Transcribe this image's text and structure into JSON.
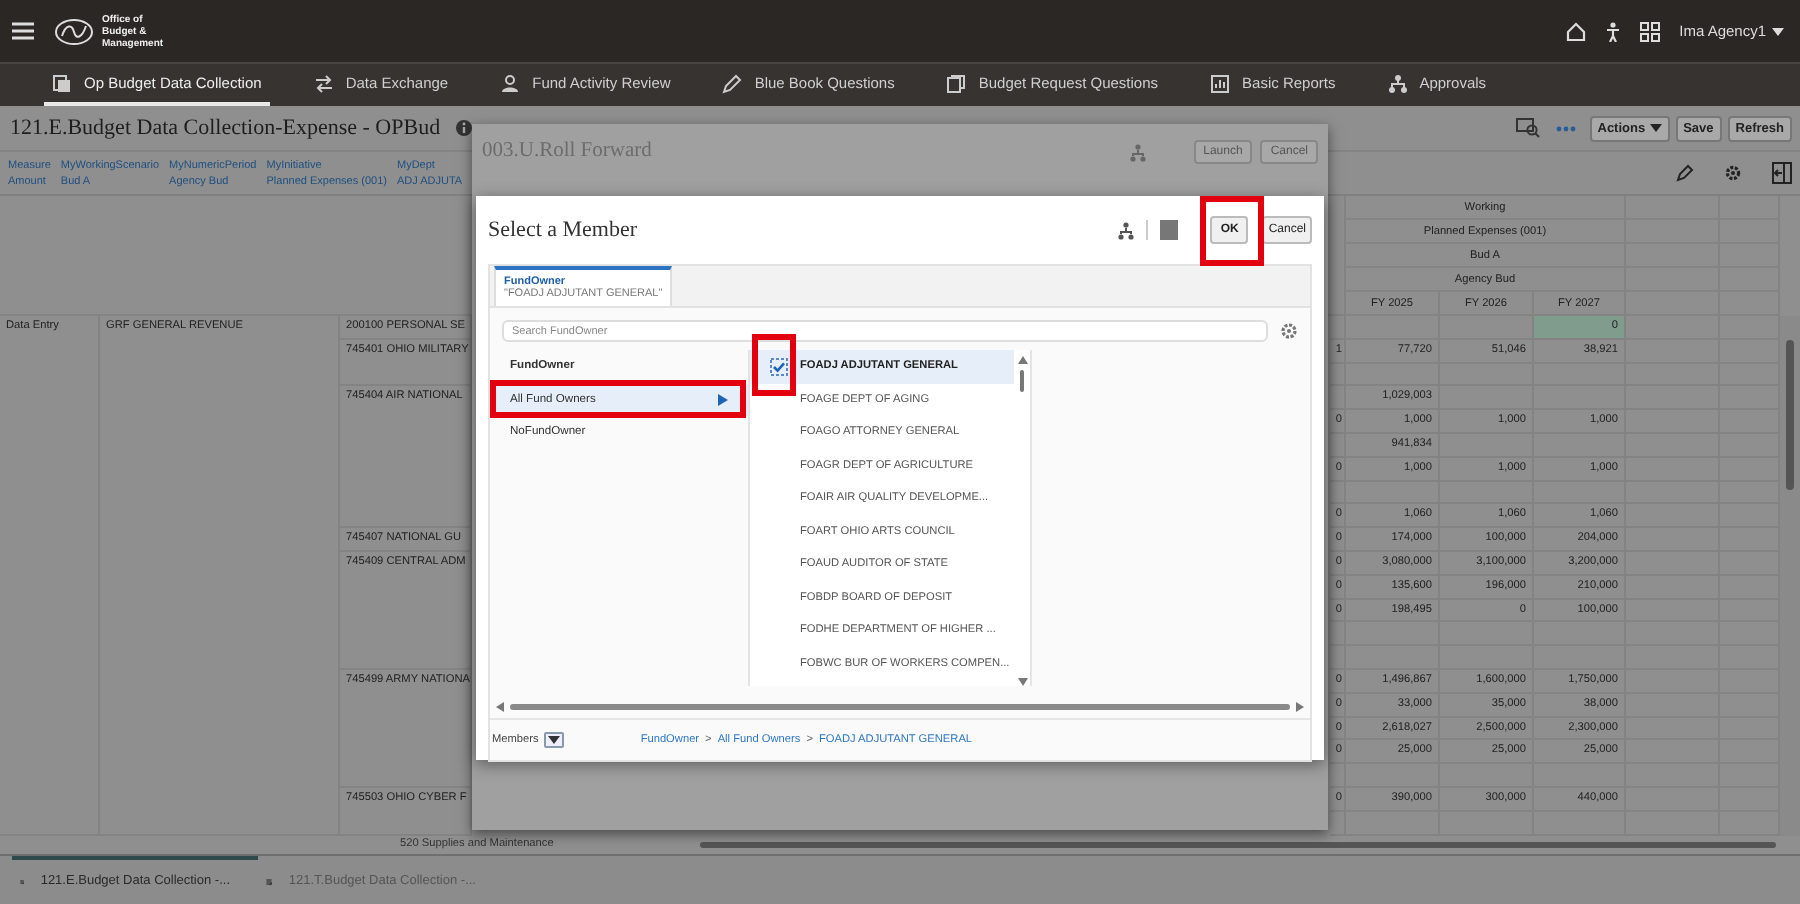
{
  "top_bar": {
    "logo_text": "Office of Budget & Management",
    "user": "Ima Agency1"
  },
  "nav_tabs": [
    {
      "label": "Op Budget Data Collection",
      "selected": true
    },
    {
      "label": "Data Exchange",
      "selected": false
    },
    {
      "label": "Fund Activity Review",
      "selected": false
    },
    {
      "label": "Blue Book Questions",
      "selected": false
    },
    {
      "label": "Budget Request Questions",
      "selected": false
    },
    {
      "label": "Basic Reports",
      "selected": false
    },
    {
      "label": "Approvals",
      "selected": false
    }
  ],
  "page": {
    "title": "121.E.Budget Data Collection-Expense - OPBud",
    "actions": "Actions",
    "save": "Save",
    "refresh": "Refresh"
  },
  "pov": [
    {
      "dimension": "Measure",
      "member": "Amount"
    },
    {
      "dimension": "MyWorkingScenario",
      "member": "Bud A"
    },
    {
      "dimension": "MyNumericPeriod",
      "member": "Agency Bud"
    },
    {
      "dimension": "MyInitiative",
      "member": "Planned Expenses (001)"
    },
    {
      "dimension": "MyDept",
      "member": "ADJ ADJUTA"
    }
  ],
  "grid": {
    "column_headers": [
      "Working",
      "Planned Expenses (001)",
      "Bud A",
      "Agency Bud"
    ],
    "years": [
      "FY 2025",
      "FY 2026",
      "FY 2027"
    ],
    "plan_type": "Data Entry",
    "fund": "GRF GENERAL REVENUE",
    "rows": [
      {
        "account": "200100 PERSONAL SE",
        "fy_2027": "0",
        "fy_2027_changed": true
      },
      {
        "account": "745401 OHIO MILITARY",
        "column_1": "1",
        "fy_2025": "77,720",
        "fy_2026": "51,046",
        "fy_2027": "38,921",
        "fy_2027_changed": false
      },
      {
        "fy_2027_changed": false
      },
      {
        "account": "745404 AIR NATIONAL",
        "fy_2025": "1,029,003",
        "fy_2027_changed": false
      },
      {
        "column_1": "0",
        "fy_2025": "1,000",
        "fy_2026": "1,000",
        "fy_2027": "1,000",
        "fy_2027_changed": false
      },
      {
        "fy_2025": "941,834",
        "fy_2027_changed": false
      },
      {
        "column_1": "0",
        "fy_2025": "1,000",
        "fy_2026": "1,000",
        "fy_2027": "1,000",
        "fy_2027_changed": false
      },
      {
        "fy_2027_changed": false
      },
      {
        "column_1": "0",
        "fy_2025": "1,060",
        "fy_2026": "1,060",
        "fy_2027": "1,060",
        "fy_2027_changed": false
      },
      {
        "account": "745407 NATIONAL GU",
        "column_1": "0",
        "fy_2025": "174,000",
        "fy_2026": "100,000",
        "fy_2027": "204,000",
        "fy_2027_changed": false
      },
      {
        "account": "745409 CENTRAL ADM",
        "column_1": "0",
        "fy_2025": "3,080,000",
        "fy_2026": "3,100,000",
        "fy_2027": "3,200,000",
        "fy_2027_changed": false
      },
      {
        "column_1": "0",
        "fy_2025": "135,600",
        "fy_2026": "196,000",
        "fy_2027": "210,000",
        "fy_2027_changed": false
      },
      {
        "column_1": "0",
        "fy_2025": "198,495",
        "fy_2026": "0",
        "fy_2027": "100,000",
        "fy_2027_changed": false
      },
      {
        "fy_2027_changed": false
      },
      {
        "fy_2027_changed": false
      },
      {
        "account": "745499 ARMY NATIONA",
        "column_1": "0",
        "fy_2025": "1,496,867",
        "fy_2026": "1,600,000",
        "fy_2027": "1,750,000",
        "fy_2027_changed": false
      },
      {
        "column_1": "0",
        "fy_2025": "33,000",
        "fy_2026": "35,000",
        "fy_2027": "38,000",
        "fy_2027_changed": false
      },
      {
        "column_1": "0",
        "fy_2025": "2,618,027",
        "fy_2026": "2,500,000",
        "fy_2027": "2,300,000",
        "fy_2027_changed": false
      },
      {
        "column_1": "0",
        "fy_2025": "25,000",
        "fy_2026": "25,000",
        "fy_2027": "25,000",
        "fy_2027_changed": false
      },
      {
        "fy_2027_changed": false
      },
      {
        "account": "745503 OHIO CYBER F",
        "column_1": "0",
        "fy_2025": "390,000",
        "fy_2026": "300,000",
        "fy_2027": "440,000",
        "fy_2027_changed": false
      },
      {
        "fy_2027_changed": false
      }
    ],
    "footer_row": "520 Supplies and Maintenance"
  },
  "roll_forward_dialog": {
    "title": "003.U.Roll Forward",
    "launch": "Launch",
    "cancel": "Cancel"
  },
  "member_dialog": {
    "title": "Select a Member",
    "ok": "OK",
    "cancel": "Cancel",
    "tab": {
      "label": "FundOwner",
      "value": "\"FOADJ ADJUTANT GENERAL\"",
      "selected": true
    },
    "search": {
      "placeholder": "Search FundOwner"
    },
    "hierarchy": [
      {
        "label": "FundOwner",
        "kind": "root",
        "selected": false
      },
      {
        "label": "All Fund Owners",
        "kind": "branch",
        "selected": true
      },
      {
        "label": "NoFundOwner",
        "kind": "leaf",
        "selected": false
      }
    ],
    "members": [
      {
        "label": "FOADJ ADJUTANT GENERAL",
        "checked": true,
        "selected": true
      },
      {
        "label": "FOAGE DEPT OF AGING",
        "checked": false,
        "selected": false
      },
      {
        "label": "FOAGO ATTORNEY GENERAL",
        "checked": false,
        "selected": false
      },
      {
        "label": "FOAGR DEPT OF AGRICULTURE",
        "checked": false,
        "selected": false
      },
      {
        "label": "FOAIR AIR QUALITY DEVELOPME...",
        "checked": false,
        "selected": false
      },
      {
        "label": "FOART OHIO ARTS COUNCIL",
        "checked": false,
        "selected": false
      },
      {
        "label": "FOAUD AUDITOR OF STATE",
        "checked": false,
        "selected": false
      },
      {
        "label": "FOBDP BOARD OF DEPOSIT",
        "checked": false,
        "selected": false
      },
      {
        "label": "FODHE DEPARTMENT OF HIGHER ...",
        "checked": false,
        "selected": false
      },
      {
        "label": "FOBWC BUR OF WORKERS COMPEN...",
        "checked": false,
        "selected": false
      }
    ],
    "view": "Members",
    "breadcrumb": [
      {
        "label": "FundOwner",
        "separator": ">"
      },
      {
        "label": "All Fund Owners",
        "separator": ">"
      },
      {
        "label": "FOADJ ADJUTANT GENERAL"
      }
    ]
  },
  "bottom_tabs": [
    {
      "label": "121.E.Budget Data Collection -...",
      "selected": true
    },
    {
      "label": "121.T.Budget Data Collection -...",
      "selected": false
    }
  ]
}
